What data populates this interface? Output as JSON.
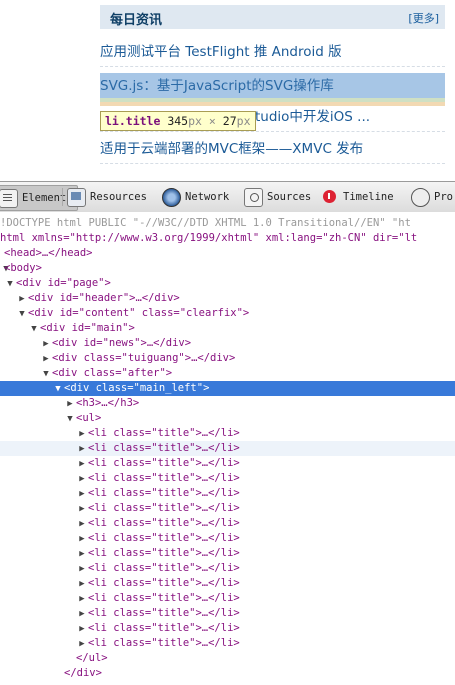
{
  "news": {
    "header_title": "每日资讯",
    "header_more": "[更多]",
    "items": [
      "应用测试平台 TestFlight 推 Android 版",
      "SVG.js：基于JavaScript的SVG操作库",
      "tudio中开发iOS ...",
      "适用于云端部署的MVC框架——XMVC 发布"
    ],
    "tooltip": {
      "selector": "li.title",
      "width": "345",
      "height": "27",
      "unit": "px",
      "times": "×"
    }
  },
  "toolbar": {
    "elements": "Elements",
    "resources": "Resources",
    "network": "Network",
    "sources": "Sources",
    "timeline": "Timeline",
    "profiles": "Pro"
  },
  "dom": {
    "doctype": "!DOCTYPE html PUBLIC \"-//W3C//DTD XHTML 1.0 Transitional//EN\" \"ht",
    "html_open": "html xmlns=\"http://www.w3.org/1999/xhtml\" xml:lang=\"zh-CN\" dir=\"lt",
    "head": "<head>…</head>",
    "body": "<body>",
    "page": "<div id=\"page\">",
    "header": "<div id=\"header\">…</div>",
    "content": "<div id=\"content\" class=\"clearfix\">",
    "main": "<div id=\"main\">",
    "news": "<div id=\"news\">…</div>",
    "tuiguang": "<div class=\"tuiguang\">…</div>",
    "after": "<div class=\"after\">",
    "main_left": "<div class=\"main_left\">",
    "h3": "<h3>…</h3>",
    "ul_open": "<ul>",
    "li_title": "<li class=\"title\">…</li>",
    "ul_close": "</ul>",
    "div_close": "</div>"
  }
}
